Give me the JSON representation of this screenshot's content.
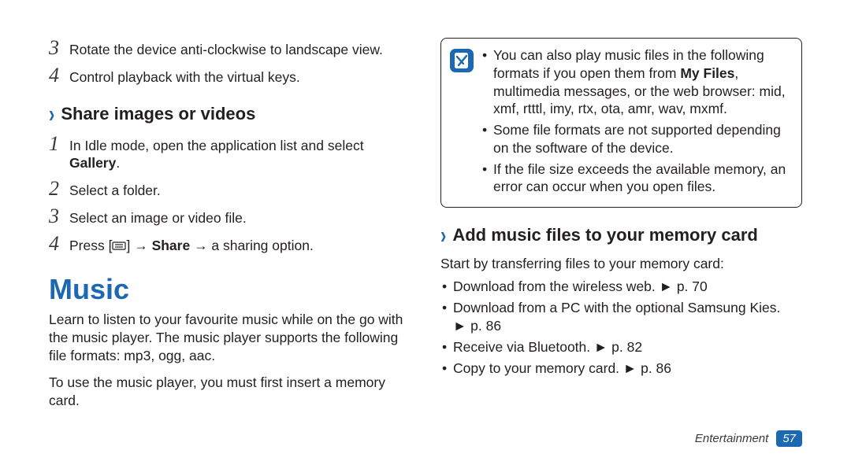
{
  "left": {
    "steps_a": [
      {
        "num": "3",
        "text": "Rotate the device anti-clockwise to landscape view."
      },
      {
        "num": "4",
        "text": "Control playback with the virtual keys."
      }
    ],
    "share_heading": "Share images or videos",
    "steps_b": [
      {
        "num": "1",
        "pre": "In Idle mode, open the application list and select ",
        "bold": "Gallery",
        "post": "."
      },
      {
        "num": "2",
        "text": "Select a folder."
      },
      {
        "num": "3",
        "text": "Select an image or video file."
      },
      {
        "num": "4",
        "press_pre": "Press [",
        "press_post": "] → ",
        "share": "Share",
        "after": " → a sharing option."
      }
    ],
    "music_heading": "Music",
    "music_p1": "Learn to listen to your favourite music while on the go with the music player. The music player supports the following file formats: mp3, ogg, aac.",
    "music_p2": "To use the music player, you must first insert a memory card."
  },
  "right": {
    "note_items": [
      {
        "pre": "You can also play music files in the following formats if you open them from ",
        "bold": "My Files",
        "post": ", multimedia messages, or the web browser: mid, xmf, rtttl, imy, rtx, ota, amr, wav, mxmf."
      },
      {
        "text": "Some file formats are not supported depending on the software of the device."
      },
      {
        "text": "If the file size exceeds the available memory, an error can occur when you open files."
      }
    ],
    "add_heading": "Add music files to your memory card",
    "add_intro": "Start by transferring files to your memory card:",
    "add_bullets": [
      {
        "text": "Download from the wireless web. ",
        "ref": "► p. 70"
      },
      {
        "text": "Download from a PC with the optional Samsung Kies.",
        "ref_below": "► p. 86"
      },
      {
        "text": "Receive via Bluetooth. ",
        "ref": "► p. 82"
      },
      {
        "text": "Copy to your memory card. ",
        "ref": "► p. 86"
      }
    ]
  },
  "footer": {
    "section": "Entertainment",
    "page": "57"
  }
}
